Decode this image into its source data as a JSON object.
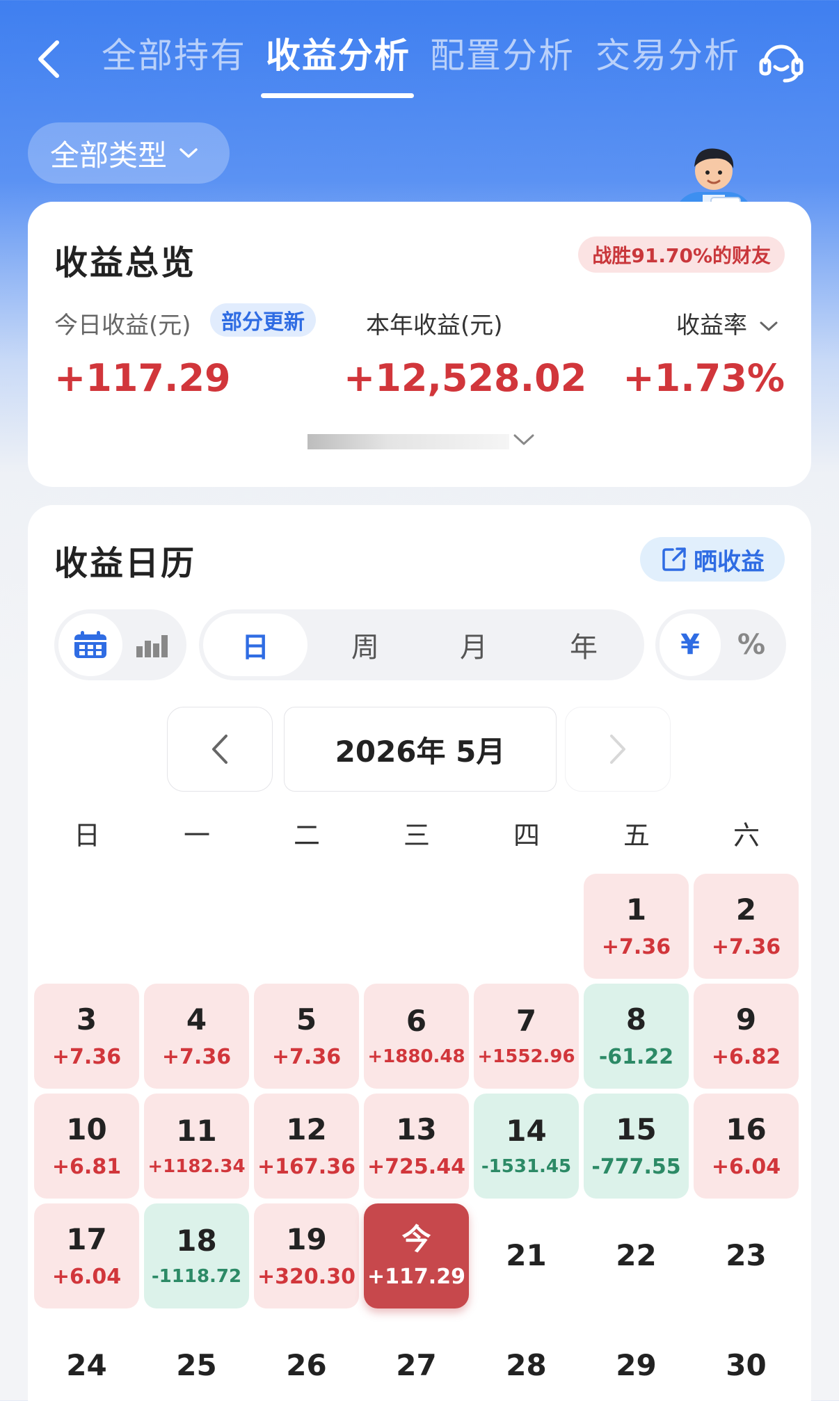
{
  "nav": {
    "tabs": [
      "全部持有",
      "收益分析",
      "配置分析",
      "交易分析"
    ],
    "active_tab": 1
  },
  "filter": {
    "label": "全部类型"
  },
  "overview": {
    "title": "收益总览",
    "rank_badge": "战胜91.70%的财友",
    "today_label": "今日收益(元)",
    "update_tag": "部分更新",
    "today_value": "+117.29",
    "year_label": "本年收益(元)",
    "year_value": "+12,528.02",
    "rate_label": "收益率",
    "rate_value": "+1.73%"
  },
  "calendar": {
    "title": "收益日历",
    "share_label": "晒收益",
    "period_tabs": [
      "日",
      "周",
      "月",
      "年"
    ],
    "active_period": 0,
    "unit_tabs": [
      "¥",
      "%"
    ],
    "active_unit": 0,
    "view_icons": [
      "calendar-icon",
      "bar-chart-icon"
    ],
    "active_view": 0,
    "month_label": "2026年 5月",
    "weekdays": [
      "日",
      "一",
      "二",
      "三",
      "四",
      "五",
      "六"
    ],
    "first_weekday": 5,
    "days": [
      {
        "num": "1",
        "val": "+7.36",
        "type": "gain"
      },
      {
        "num": "2",
        "val": "+7.36",
        "type": "gain"
      },
      {
        "num": "3",
        "val": "+7.36",
        "type": "gain"
      },
      {
        "num": "4",
        "val": "+7.36",
        "type": "gain"
      },
      {
        "num": "5",
        "val": "+7.36",
        "type": "gain"
      },
      {
        "num": "6",
        "val": "+1880.48",
        "type": "gain"
      },
      {
        "num": "7",
        "val": "+1552.96",
        "type": "gain"
      },
      {
        "num": "8",
        "val": "-61.22",
        "type": "loss"
      },
      {
        "num": "9",
        "val": "+6.82",
        "type": "gain"
      },
      {
        "num": "10",
        "val": "+6.81",
        "type": "gain"
      },
      {
        "num": "11",
        "val": "+1182.34",
        "type": "gain"
      },
      {
        "num": "12",
        "val": "+167.36",
        "type": "gain"
      },
      {
        "num": "13",
        "val": "+725.44",
        "type": "gain"
      },
      {
        "num": "14",
        "val": "-1531.45",
        "type": "loss"
      },
      {
        "num": "15",
        "val": "-777.55",
        "type": "loss"
      },
      {
        "num": "16",
        "val": "+6.04",
        "type": "gain"
      },
      {
        "num": "17",
        "val": "+6.04",
        "type": "gain"
      },
      {
        "num": "18",
        "val": "-1118.72",
        "type": "loss"
      },
      {
        "num": "19",
        "val": "+320.30",
        "type": "gain"
      },
      {
        "num": "今",
        "val": "+117.29",
        "type": "today"
      },
      {
        "num": "21",
        "val": "",
        "type": "empty"
      },
      {
        "num": "22",
        "val": "",
        "type": "empty"
      },
      {
        "num": "23",
        "val": "",
        "type": "empty"
      },
      {
        "num": "24",
        "val": "",
        "type": "empty"
      },
      {
        "num": "25",
        "val": "",
        "type": "empty"
      },
      {
        "num": "26",
        "val": "",
        "type": "empty"
      },
      {
        "num": "27",
        "val": "",
        "type": "empty"
      },
      {
        "num": "28",
        "val": "",
        "type": "empty"
      },
      {
        "num": "29",
        "val": "",
        "type": "empty"
      },
      {
        "num": "30",
        "val": "",
        "type": "empty"
      }
    ]
  },
  "colors": {
    "primary_blue": "#3f7ff0",
    "gain_red": "#d1363b",
    "loss_green": "#2c8a66",
    "today_bg": "#c7484c"
  }
}
